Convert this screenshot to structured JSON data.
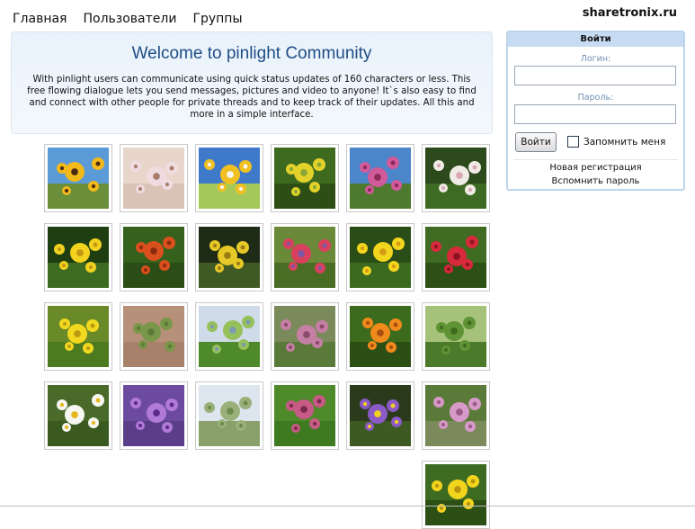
{
  "nav": {
    "items": [
      "Главная",
      "Пользователи",
      "Группы"
    ]
  },
  "brand": "sharetronix.ru",
  "welcome": {
    "title": "Welcome to pinlight Community",
    "text": "With pinlight users can communicate using quick status updates of 160 characters or less. This free flowing dialogue lets you send messages, pictures and video to anyone! It`s also easy to find and connect with other people for private threads and to keep track of their updates. All this and more in a simple interface."
  },
  "login": {
    "title": "Войти",
    "login_label": "Логин:",
    "password_label": "Пароль:",
    "login_value": "",
    "password_value": "",
    "button_label": "Войти",
    "remember_label": "Запомнить меня",
    "remember_checked": false,
    "register_link": "Новая регистрация",
    "forgot_link": "Вспомнить пароль"
  },
  "gallery": {
    "photos": [
      {
        "subject": "sunflower",
        "sky": "#5a9ad6",
        "ground": "#6a8e3a",
        "bloom": "#f2b91a",
        "center": "#4a2a10"
      },
      {
        "subject": "pale pink meadow",
        "sky": "#e8d6cc",
        "ground": "#d9c2b6",
        "bloom": "#f0dce0",
        "center": "#a77c6c"
      },
      {
        "subject": "dandelions on blue sky",
        "sky": "#3f79c9",
        "ground": "#a4c95a",
        "bloom": "#f0c020",
        "center": "#f5f5f5"
      },
      {
        "subject": "yellow flowers with leaves",
        "sky": "#3d6a1f",
        "ground": "#2d4f15",
        "bloom": "#e3d229",
        "center": "#8aa638"
      },
      {
        "subject": "pink hollyhocks",
        "sky": "#4a86c9",
        "ground": "#4d7a2f",
        "bloom": "#d15a9a",
        "center": "#8a2a5a"
      },
      {
        "subject": "white lilies",
        "sky": "#2c4a1c",
        "ground": "#3e6b23",
        "bloom": "#f1ebe6",
        "center": "#d8a7b4"
      },
      {
        "subject": "yellow flower dark leaves",
        "sky": "#1f3f12",
        "ground": "#3e6b22",
        "bloom": "#f1d21f",
        "center": "#c39714"
      },
      {
        "subject": "orange marigolds",
        "sky": "#35611d",
        "ground": "#2b4d16",
        "bloom": "#d9501e",
        "center": "#8a2b10"
      },
      {
        "subject": "yellow bloom bush",
        "sky": "#1e2b17",
        "ground": "#3f5a25",
        "bloom": "#e6c926",
        "center": "#9a7a15"
      },
      {
        "subject": "gladiolus",
        "sky": "#6a8a3a",
        "ground": "#4a6d25",
        "bloom": "#d8405e",
        "center": "#7a58a6"
      },
      {
        "subject": "yellow irises",
        "sky": "#2a4d17",
        "ground": "#3c6b20",
        "bloom": "#f4d51e",
        "center": "#d49b12"
      },
      {
        "subject": "red geraniums",
        "sky": "#3f6b22",
        "ground": "#2c5015",
        "bloom": "#d62a3c",
        "center": "#8a1320"
      },
      {
        "subject": "yellow flowers on grass",
        "sky": "#6a8a2a",
        "ground": "#4d7a1f",
        "bloom": "#f2d81f",
        "center": "#b99a10"
      },
      {
        "subject": "soil and seedlings",
        "sky": "#b7907a",
        "ground": "#a8816a",
        "bloom": "#79964a",
        "center": "#5e7a38"
      },
      {
        "subject": "stream in meadow",
        "sky": "#cfdbe8",
        "ground": "#4f8a2a",
        "bloom": "#96c15a",
        "center": "#7c9ab3"
      },
      {
        "subject": "pink clover meadow",
        "sky": "#7a8a5a",
        "ground": "#5a7a3a",
        "bloom": "#c57fa4",
        "center": "#8a4a6a"
      },
      {
        "subject": "orange calendula",
        "sky": "#3c6b1e",
        "ground": "#2b4f15",
        "bloom": "#f08a1a",
        "center": "#a84e10"
      },
      {
        "subject": "nettle leaves",
        "sky": "#a6c27a",
        "ground": "#4a7a2a",
        "bloom": "#5f9436",
        "center": "#3e6b1f"
      },
      {
        "subject": "white daisies",
        "sky": "#4a6a2a",
        "ground": "#3a5a1f",
        "bloom": "#f7f7f2",
        "center": "#e3b91d"
      },
      {
        "subject": "violet phlox",
        "sky": "#6b4aa0",
        "ground": "#5a3e8a",
        "bloom": "#b07ad6",
        "center": "#5a2a8a"
      },
      {
        "subject": "green field and sky",
        "sky": "#dde6ee",
        "ground": "#8aa06a",
        "bloom": "#9ab07a",
        "center": "#6a8a4a"
      },
      {
        "subject": "red clover",
        "sky": "#4f8a2a",
        "ground": "#3e7a20",
        "bloom": "#c85a86",
        "center": "#7a2a4a"
      },
      {
        "subject": "purple violets",
        "sky": "#2a3a1a",
        "ground": "#3c5a22",
        "bloom": "#8a5ac6",
        "center": "#f2d21f"
      },
      {
        "subject": "pink petunias",
        "sky": "#5a7a3a",
        "ground": "#7a8a5a",
        "bloom": "#d79ac8",
        "center": "#9a5a8a"
      },
      {
        "subject": "yellow flowers bottom",
        "sky": "#3e6b22",
        "ground": "#2b4f15",
        "bloom": "#f3d41c",
        "center": "#b8930f"
      }
    ]
  }
}
